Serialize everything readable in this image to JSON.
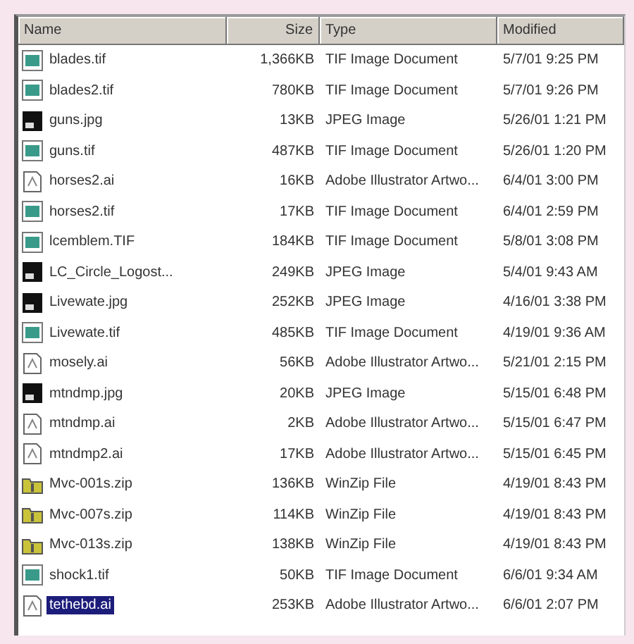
{
  "columns": [
    "Name",
    "Size",
    "Type",
    "Modified"
  ],
  "rows": [
    {
      "kind": "tif",
      "name": "blades.tif",
      "size": "1,366KB",
      "type": "TIF Image Document",
      "modified": "5/7/01 9:25 PM",
      "selected": false
    },
    {
      "kind": "tif",
      "name": "blades2.tif",
      "size": "780KB",
      "type": "TIF Image Document",
      "modified": "5/7/01 9:26 PM",
      "selected": false
    },
    {
      "kind": "jpg",
      "name": "guns.jpg",
      "size": "13KB",
      "type": "JPEG Image",
      "modified": "5/26/01 1:21 PM",
      "selected": false
    },
    {
      "kind": "tif",
      "name": "guns.tif",
      "size": "487KB",
      "type": "TIF Image Document",
      "modified": "5/26/01 1:20 PM",
      "selected": false
    },
    {
      "kind": "ai",
      "name": "horses2.ai",
      "size": "16KB",
      "type": "Adobe Illustrator Artwo...",
      "modified": "6/4/01 3:00 PM",
      "selected": false
    },
    {
      "kind": "tif",
      "name": "horses2.tif",
      "size": "17KB",
      "type": "TIF Image Document",
      "modified": "6/4/01 2:59 PM",
      "selected": false
    },
    {
      "kind": "tif",
      "name": "lcemblem.TIF",
      "size": "184KB",
      "type": "TIF Image Document",
      "modified": "5/8/01 3:08 PM",
      "selected": false
    },
    {
      "kind": "jpg",
      "name": "LC_Circle_Logost...",
      "size": "249KB",
      "type": "JPEG Image",
      "modified": "5/4/01 9:43 AM",
      "selected": false
    },
    {
      "kind": "jpg",
      "name": "Livewate.jpg",
      "size": "252KB",
      "type": "JPEG Image",
      "modified": "4/16/01 3:38 PM",
      "selected": false
    },
    {
      "kind": "tif",
      "name": "Livewate.tif",
      "size": "485KB",
      "type": "TIF Image Document",
      "modified": "4/19/01 9:36 AM",
      "selected": false
    },
    {
      "kind": "ai",
      "name": "mosely.ai",
      "size": "56KB",
      "type": "Adobe Illustrator Artwo...",
      "modified": "5/21/01 2:15 PM",
      "selected": false
    },
    {
      "kind": "jpg",
      "name": "mtndmp.jpg",
      "size": "20KB",
      "type": "JPEG Image",
      "modified": "5/15/01 6:48 PM",
      "selected": false
    },
    {
      "kind": "ai",
      "name": "mtndmp.ai",
      "size": "2KB",
      "type": "Adobe Illustrator Artwo...",
      "modified": "5/15/01 6:47 PM",
      "selected": false
    },
    {
      "kind": "ai",
      "name": "mtndmp2.ai",
      "size": "17KB",
      "type": "Adobe Illustrator Artwo...",
      "modified": "5/15/01 6:45 PM",
      "selected": false
    },
    {
      "kind": "zip",
      "name": "Mvc-001s.zip",
      "size": "136KB",
      "type": "WinZip File",
      "modified": "4/19/01 8:43 PM",
      "selected": false
    },
    {
      "kind": "zip",
      "name": "Mvc-007s.zip",
      "size": "114KB",
      "type": "WinZip File",
      "modified": "4/19/01 8:43 PM",
      "selected": false
    },
    {
      "kind": "zip",
      "name": "Mvc-013s.zip",
      "size": "138KB",
      "type": "WinZip File",
      "modified": "4/19/01 8:43 PM",
      "selected": false
    },
    {
      "kind": "tif",
      "name": "shock1.tif",
      "size": "50KB",
      "type": "TIF Image Document",
      "modified": "6/6/01 9:34 AM",
      "selected": false
    },
    {
      "kind": "ai",
      "name": "tethebd.ai",
      "size": "253KB",
      "type": "Adobe Illustrator Artwo...",
      "modified": "6/6/01 2:07 PM",
      "selected": true
    }
  ]
}
